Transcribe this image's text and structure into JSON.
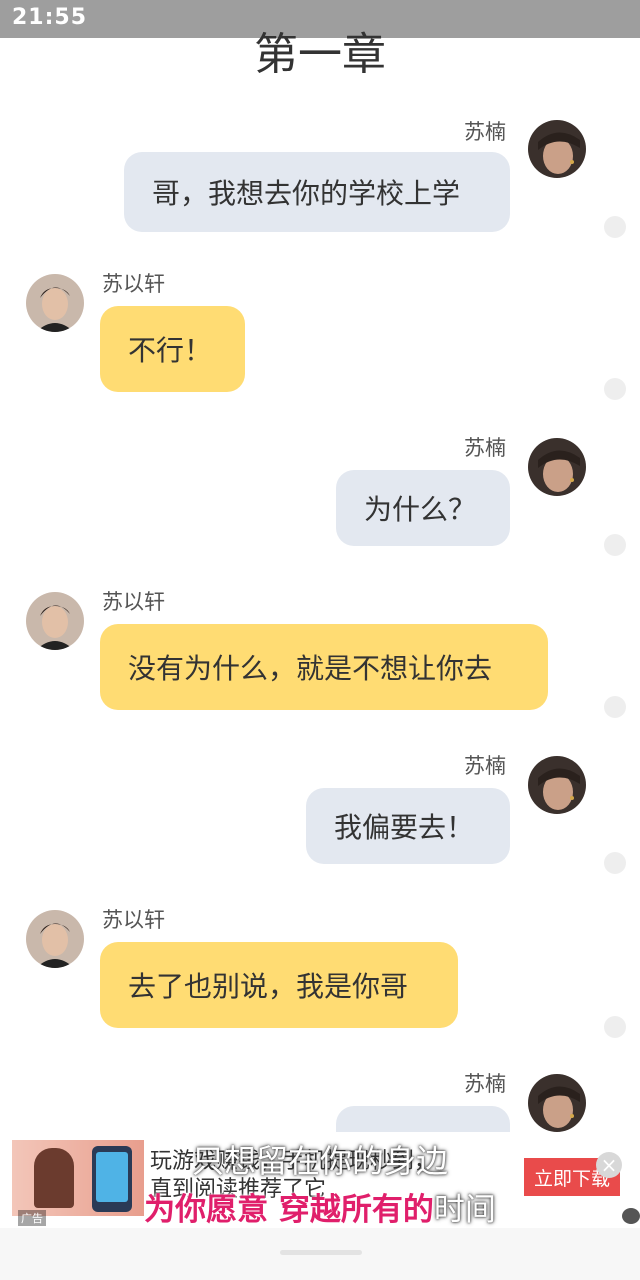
{
  "status_bar": {
    "time": "21:55"
  },
  "chapter": {
    "title": "第一章"
  },
  "messages": [
    {
      "sender": "苏楠",
      "text": "哥，我想去你的学校上学"
    },
    {
      "sender": "苏以轩",
      "text": "不行！"
    },
    {
      "sender": "苏楠",
      "text": "为什么？"
    },
    {
      "sender": "苏以轩",
      "text": "没有为什么，就是不想让你去"
    },
    {
      "sender": "苏楠",
      "text": "我偏要去！"
    },
    {
      "sender": "苏以轩",
      "text": "去了也别说，我是你哥"
    },
    {
      "sender": "苏楠",
      "text": ""
    }
  ],
  "ad": {
    "tag": "广告",
    "line1": "玩游戏赚钱，手机提现秒到，",
    "line2": "直到阅读推荐了它",
    "button": "立即下载",
    "close": "×"
  },
  "subtitles": {
    "line1": "只想留在你的身边",
    "line2_highlight": "为你愿意 穿越所有的",
    "line2_rest": "时间"
  },
  "colors": {
    "right_bubble": "#e3e8f0",
    "left_bubble": "#ffdc73",
    "accent_subtitle": "#e01f6b"
  }
}
